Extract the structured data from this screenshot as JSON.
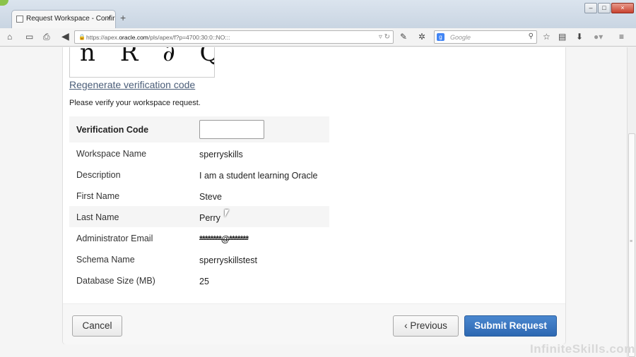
{
  "browser": {
    "tab_title": "Request Workspace - Confirm...",
    "new_tab_symbol": "+",
    "url_prefix": "https://apex.",
    "url_host": "oracle.com",
    "url_path": "/pls/apex/f?p=4700:30:0::NO:::",
    "search_placeholder": "Google"
  },
  "captcha": {
    "glyphs": "n R ∂ Q D"
  },
  "form": {
    "regenerate_link": "Regenerate verification code",
    "intro": "Please verify your workspace request.",
    "verification_label": "Verification Code",
    "verification_value": "",
    "rows": [
      {
        "label": "Workspace Name",
        "value": "sperryskills"
      },
      {
        "label": "Description",
        "value": "I am a student learning Oracle"
      },
      {
        "label": "First Name",
        "value": "Steve"
      },
      {
        "label": "Last Name",
        "value": "Perry"
      },
      {
        "label": "Administrator Email",
        "value": "********@*******"
      },
      {
        "label": "Schema Name",
        "value": "sperryskillstest"
      },
      {
        "label": "Database Size (MB)",
        "value": "25"
      }
    ]
  },
  "buttons": {
    "cancel": "Cancel",
    "previous": "‹ Previous",
    "submit": "Submit Request"
  },
  "watermark": "InfiniteSkills.com"
}
